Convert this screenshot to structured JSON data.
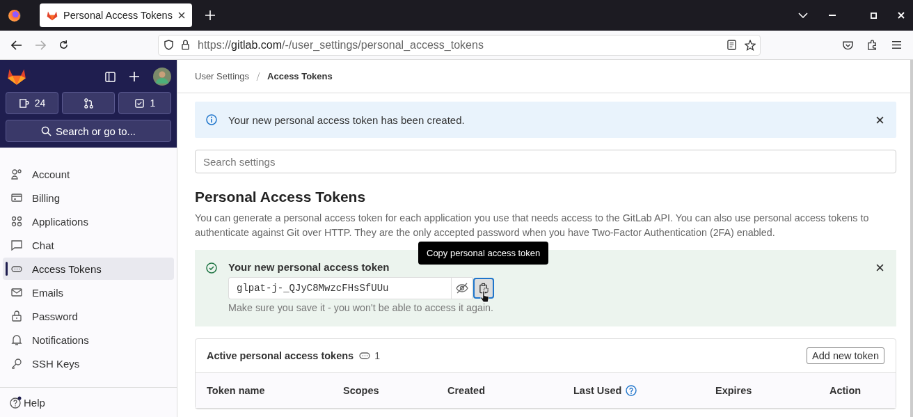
{
  "browser": {
    "tab_title": "Personal Access Tokens",
    "url_scheme": "https://",
    "url_host": "gitlab.com",
    "url_path": "/-/user_settings/personal_access_tokens"
  },
  "sidebar": {
    "counters": [
      {
        "kind": "issues",
        "count": "24"
      },
      {
        "kind": "merge_requests"
      },
      {
        "kind": "todos",
        "count": "1"
      }
    ],
    "search": {
      "placeholder": "Search or go to..."
    },
    "items": [
      {
        "label": "Account",
        "kind": "account",
        "selected": false
      },
      {
        "label": "Billing",
        "kind": "billing",
        "selected": false
      },
      {
        "label": "Applications",
        "kind": "applications",
        "selected": false
      },
      {
        "label": "Chat",
        "kind": "chat",
        "selected": false
      },
      {
        "label": "Access Tokens",
        "kind": "token",
        "selected": true
      },
      {
        "label": "Emails",
        "kind": "email",
        "selected": false
      },
      {
        "label": "Password",
        "kind": "password",
        "selected": false
      },
      {
        "label": "Notifications",
        "kind": "notifications",
        "selected": false
      },
      {
        "label": "SSH Keys",
        "kind": "key",
        "selected": false
      }
    ],
    "help": "Help"
  },
  "breadcrumbs": [
    "User Settings",
    "Access Tokens"
  ],
  "info_alert": "Your new personal access token has been created.",
  "settings_search": {
    "placeholder": "Search settings"
  },
  "heading": "Personal Access Tokens",
  "description": "You can generate a personal access token for each application you use that needs access to the GitLab API. You can also use personal access tokens to authenticate against Git over HTTP. They are the only accepted password when you have Two-Factor Authentication (2FA) enabled.",
  "token_alert": {
    "title": "Your new personal access token",
    "value": "glpat-j-_QJyC8MwzcFHsSfUUu",
    "hint": "Make sure you save it - you won't be able to access it again.",
    "tooltip": "Copy personal access token"
  },
  "tokens_card": {
    "title": "Active personal access tokens",
    "count": "1",
    "add_button": "Add new token",
    "columns": [
      {
        "label": "Token name"
      },
      {
        "label": "Scopes"
      },
      {
        "label": "Created"
      },
      {
        "label": "Last Used",
        "help": true
      },
      {
        "label": "Expires"
      },
      {
        "label": "Action"
      }
    ]
  }
}
